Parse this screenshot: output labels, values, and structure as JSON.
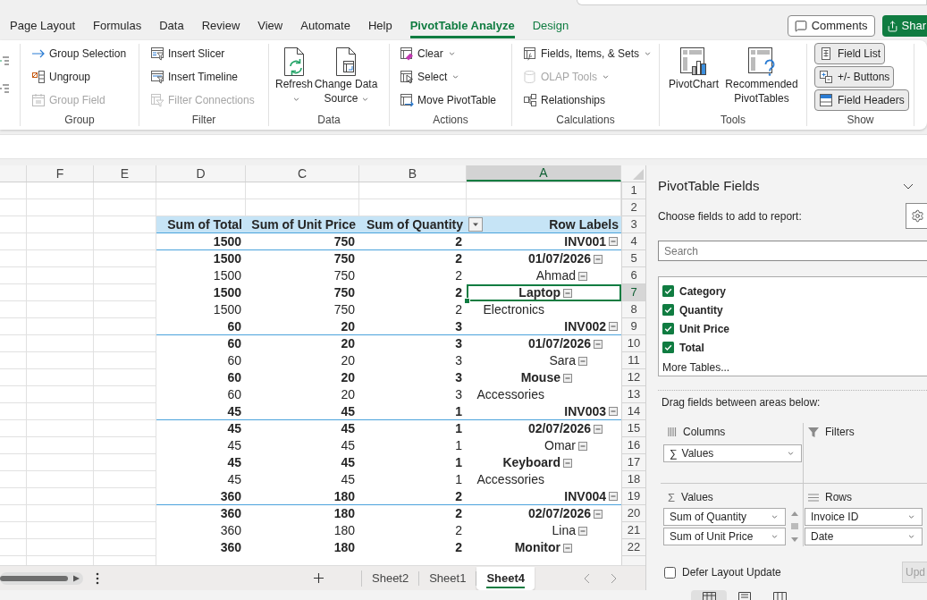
{
  "ribbon": {
    "tabs": [
      {
        "label": "Page Layout",
        "kind": "standard",
        "selected": false
      },
      {
        "label": "Formulas",
        "kind": "standard",
        "selected": false
      },
      {
        "label": "Data",
        "kind": "standard",
        "selected": false
      },
      {
        "label": "Review",
        "kind": "standard",
        "selected": false
      },
      {
        "label": "View",
        "kind": "standard",
        "selected": false
      },
      {
        "label": "Automate",
        "kind": "standard",
        "selected": false
      },
      {
        "label": "Help",
        "kind": "standard",
        "selected": false
      },
      {
        "label": "PivotTable Analyze",
        "kind": "contextual",
        "selected": true
      },
      {
        "label": "Design",
        "kind": "contextual",
        "selected": false
      }
    ],
    "comments_button": "Comments",
    "share_button": "Shar",
    "groups": [
      {
        "label": "Group",
        "kind": "small",
        "items": [
          {
            "label": "Group Selection",
            "disabled": false
          },
          {
            "label": "Ungroup",
            "disabled": false
          },
          {
            "label": "Group Field",
            "disabled": true
          }
        ]
      },
      {
        "label": "Filter",
        "kind": "small",
        "items": [
          {
            "label": "Insert Slicer",
            "disabled": false
          },
          {
            "label": "Insert Timeline",
            "disabled": false
          },
          {
            "label": "Filter Connections",
            "disabled": true
          }
        ]
      },
      {
        "label": "Data",
        "kind": "large",
        "items": [
          {
            "label": "Refresh",
            "dropdown": true
          },
          {
            "label": "Change Data Source",
            "dropdown": true
          }
        ]
      },
      {
        "label": "Actions",
        "kind": "small",
        "items": [
          {
            "label": "Clear",
            "dropdown": true,
            "disabled": false
          },
          {
            "label": "Select",
            "dropdown": true,
            "disabled": false
          },
          {
            "label": "Move PivotTable",
            "disabled": false
          }
        ]
      },
      {
        "label": "Calculations",
        "kind": "small",
        "items": [
          {
            "label": "Fields, Items, & Sets",
            "dropdown": true,
            "disabled": false
          },
          {
            "label": "OLAP Tools",
            "dropdown": true,
            "disabled": true
          },
          {
            "label": "Relationships",
            "disabled": false
          }
        ]
      },
      {
        "label": "Tools",
        "kind": "large",
        "items": [
          {
            "label": "PivotChart"
          },
          {
            "label": "Recommended PivotTables"
          }
        ]
      },
      {
        "label": "Show",
        "kind": "toggle",
        "items": [
          {
            "label": "Field List",
            "on": true
          },
          {
            "label": "+/- Buttons",
            "on": true
          },
          {
            "label": "Field Headers",
            "on": true
          }
        ]
      }
    ]
  },
  "sheet": {
    "columns": [
      {
        "label": "F",
        "selected": false
      },
      {
        "label": "E",
        "selected": false
      },
      {
        "label": "D",
        "selected": false
      },
      {
        "label": "C",
        "selected": false
      },
      {
        "label": "B",
        "selected": false
      },
      {
        "label": "A",
        "selected": true
      }
    ],
    "row_numbers": [
      "1",
      "2",
      "3",
      "4",
      "5",
      "6",
      "7",
      "8",
      "9",
      "10",
      "11",
      "12",
      "13",
      "14",
      "15",
      "16",
      "17",
      "18",
      "19",
      "20",
      "21",
      "22"
    ],
    "pivot": {
      "headers": {
        "total": "Sum of Total",
        "unit_price": "Sum of Unit Price",
        "quantity": "Sum of Quantity",
        "row_labels": "Row Labels"
      },
      "rows": [
        {
          "label": "INV001",
          "quantity": "2",
          "unit_price": "750",
          "total": "1500",
          "expanded": true,
          "selected": false,
          "children": [
            {
              "label": "01/07/2026",
              "quantity": "2",
              "unit_price": "750",
              "total": "1500",
              "expanded": true,
              "selected": false,
              "children": [
                {
                  "label": "Ahmad",
                  "quantity": "2",
                  "unit_price": "750",
                  "total": "1500",
                  "expanded": true,
                  "selected": false,
                  "children": [
                    {
                      "label": "Laptop",
                      "quantity": "2",
                      "unit_price": "750",
                      "total": "1500",
                      "expanded": true,
                      "selected": true,
                      "children": [
                        {
                          "label": "Electronics",
                          "quantity": "2",
                          "unit_price": "750",
                          "total": "1500",
                          "selected": false
                        }
                      ]
                    }
                  ]
                }
              ]
            }
          ]
        },
        {
          "label": "INV002",
          "quantity": "3",
          "unit_price": "20",
          "total": "60",
          "expanded": true,
          "selected": false,
          "children": [
            {
              "label": "01/07/2026",
              "quantity": "3",
              "unit_price": "20",
              "total": "60",
              "expanded": true,
              "selected": false,
              "children": [
                {
                  "label": "Sara",
                  "quantity": "3",
                  "unit_price": "20",
                  "total": "60",
                  "expanded": true,
                  "selected": false,
                  "children": [
                    {
                      "label": "Mouse",
                      "quantity": "3",
                      "unit_price": "20",
                      "total": "60",
                      "expanded": true,
                      "selected": false,
                      "children": [
                        {
                          "label": "Accessories",
                          "quantity": "3",
                          "unit_price": "20",
                          "total": "60",
                          "selected": false
                        }
                      ]
                    }
                  ]
                }
              ]
            }
          ]
        },
        {
          "label": "INV003",
          "quantity": "1",
          "unit_price": "45",
          "total": "45",
          "expanded": true,
          "selected": false,
          "children": [
            {
              "label": "02/07/2026",
              "quantity": "1",
              "unit_price": "45",
              "total": "45",
              "expanded": true,
              "selected": false,
              "children": [
                {
                  "label": "Omar",
                  "quantity": "1",
                  "unit_price": "45",
                  "total": "45",
                  "expanded": true,
                  "selected": false,
                  "children": [
                    {
                      "label": "Keyboard",
                      "quantity": "1",
                      "unit_price": "45",
                      "total": "45",
                      "expanded": true,
                      "selected": false,
                      "children": [
                        {
                          "label": "Accessories",
                          "quantity": "1",
                          "unit_price": "45",
                          "total": "45",
                          "selected": false
                        }
                      ]
                    }
                  ]
                }
              ]
            }
          ]
        },
        {
          "label": "INV004",
          "quantity": "2",
          "unit_price": "180",
          "total": "360",
          "expanded": true,
          "selected": false,
          "children": [
            {
              "label": "02/07/2026",
              "quantity": "2",
              "unit_price": "180",
              "total": "360",
              "expanded": true,
              "selected": false,
              "children": [
                {
                  "label": "Lina",
                  "quantity": "2",
                  "unit_price": "180",
                  "total": "360",
                  "expanded": true,
                  "selected": false,
                  "children": [
                    {
                      "label": "Monitor",
                      "quantity": "2",
                      "unit_price": "180",
                      "total": "360",
                      "expanded": true,
                      "selected": false
                    }
                  ]
                }
              ]
            }
          ]
        }
      ]
    },
    "tabs": [
      {
        "label": "Sheet2",
        "selected": false
      },
      {
        "label": "Sheet1",
        "selected": false
      },
      {
        "label": "Sheet4",
        "selected": true
      }
    ]
  },
  "field_pane": {
    "title": "PivotTable Fields",
    "subtitle": "Choose fields to add to report:",
    "search": {
      "placeholder": "Search"
    },
    "fields": [
      {
        "label": "Category",
        "checked": true
      },
      {
        "label": "Quantity",
        "checked": true
      },
      {
        "label": "Unit Price",
        "checked": true
      },
      {
        "label": "Total",
        "checked": true
      }
    ],
    "more_tables": "More Tables...",
    "areas_hint": "Drag fields between areas below:",
    "areas": [
      {
        "kind": "columns",
        "label": "Columns",
        "items": [
          {
            "symbol": "∑",
            "label": "Values"
          }
        ]
      },
      {
        "kind": "filters",
        "label": "Filters"
      },
      {
        "kind": "values",
        "symbol": "Σ",
        "label": "Values",
        "items": [
          {
            "label": "Sum of Quantity"
          },
          {
            "label": "Sum of Unit Price"
          }
        ]
      },
      {
        "kind": "rows",
        "label": "Rows",
        "items": [
          {
            "label": "Invoice ID"
          },
          {
            "label": "Date"
          }
        ]
      }
    ],
    "defer_update": {
      "label": "Defer Layout Update",
      "checked": false
    },
    "update_button": {
      "label": "Upd",
      "disabled": true
    }
  }
}
